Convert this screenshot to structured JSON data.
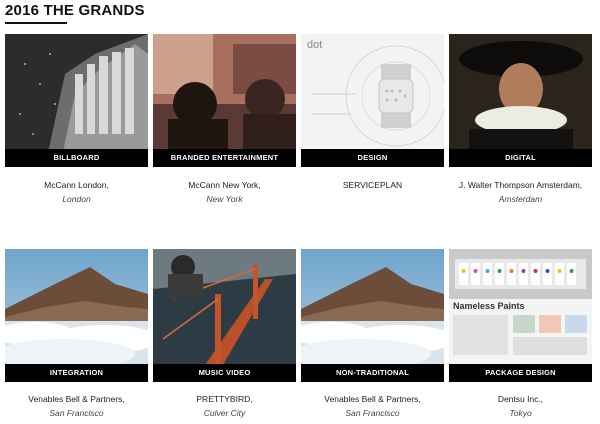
{
  "header": {
    "title": "2016 THE GRANDS"
  },
  "cards": [
    {
      "category": "BILLBOARD",
      "agency": "McCann London,",
      "city": "London",
      "image": "statues-photo"
    },
    {
      "category": "BRANDED ENTERTAINMENT",
      "agency": "McCann New York,",
      "city": "New York",
      "image": "people-silhouette-photo"
    },
    {
      "category": "DESIGN",
      "agency": "SERVICEPLAN",
      "city": "",
      "image": "braille-watch-photo"
    },
    {
      "category": "DIGITAL",
      "agency": "J. Walter Thompson Amsterdam,",
      "city": "Amsterdam",
      "image": "rembrandt-portrait"
    },
    {
      "category": "INTEGRATION",
      "agency": "Venables Bell & Partners,",
      "city": "San Francisco",
      "image": "mountain-clouds-photo"
    },
    {
      "category": "MUSIC VIDEO",
      "agency": "PRETTYBIRD,",
      "city": "Culver City",
      "image": "golden-gate-bridge-photo"
    },
    {
      "category": "NON-TRADITIONAL",
      "agency": "Venables Bell & Partners,",
      "city": "San Francisco",
      "image": "mountain-clouds-photo"
    },
    {
      "category": "PACKAGE DESIGN",
      "agency": "Dentsu Inc.,",
      "city": "Tokyo",
      "image": "paint-palette-photo"
    }
  ],
  "image_texts": {
    "design_logo": "dot",
    "package_title": "Nameless Paints"
  }
}
